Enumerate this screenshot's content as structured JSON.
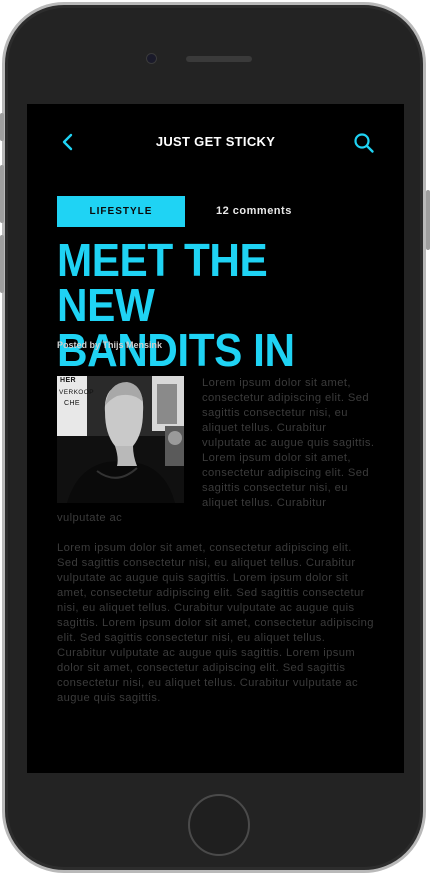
{
  "header": {
    "title": "JUST GET STICKY",
    "back_icon": "chevron-left-icon",
    "search_icon": "search-icon",
    "accent_color": "#1fd3f4"
  },
  "meta": {
    "category": "LIFESTYLE",
    "comments": "12 comments"
  },
  "article": {
    "title_line1": "MEET THE NEW",
    "title_line2": "BANDITS IN TOWN",
    "byline_prefix": "Posted by",
    "author": "Thijs Mensink",
    "image_sign_text_1": "HER",
    "image_sign_text_2": "VERKOOP",
    "image_sign_text_3": "CHE",
    "paragraph1": "Lorem ipsum dolor sit amet, consectetur adipiscing elit. Sed sagittis consectetur nisi, eu aliquet tellus. Curabitur vulputate ac augue quis sagittis. Lorem ipsum dolor sit amet, consectetur adipiscing elit. Sed sagittis consectetur nisi, eu aliquet tellus. Curabitur vulputate ac",
    "paragraph2": "Lorem ipsum dolor sit amet, consectetur adipiscing elit. Sed sagittis consectetur nisi, eu aliquet tellus. Curabitur vulputate ac augue quis sagittis. Lorem ipsum dolor sit amet, consectetur adipiscing elit. Sed sagittis consectetur nisi, eu aliquet tellus. Curabitur vulputate ac augue quis sagittis. Lorem ipsum dolor sit amet, consectetur adipiscing elit. Sed sagittis consectetur nisi, eu aliquet tellus. Curabitur vulputate ac augue quis sagittis. Lorem ipsum dolor sit amet, consectetur adipiscing elit. Sed sagittis consectetur nisi, eu aliquet tellus. Curabitur vulputate ac augue quis sagittis."
  }
}
